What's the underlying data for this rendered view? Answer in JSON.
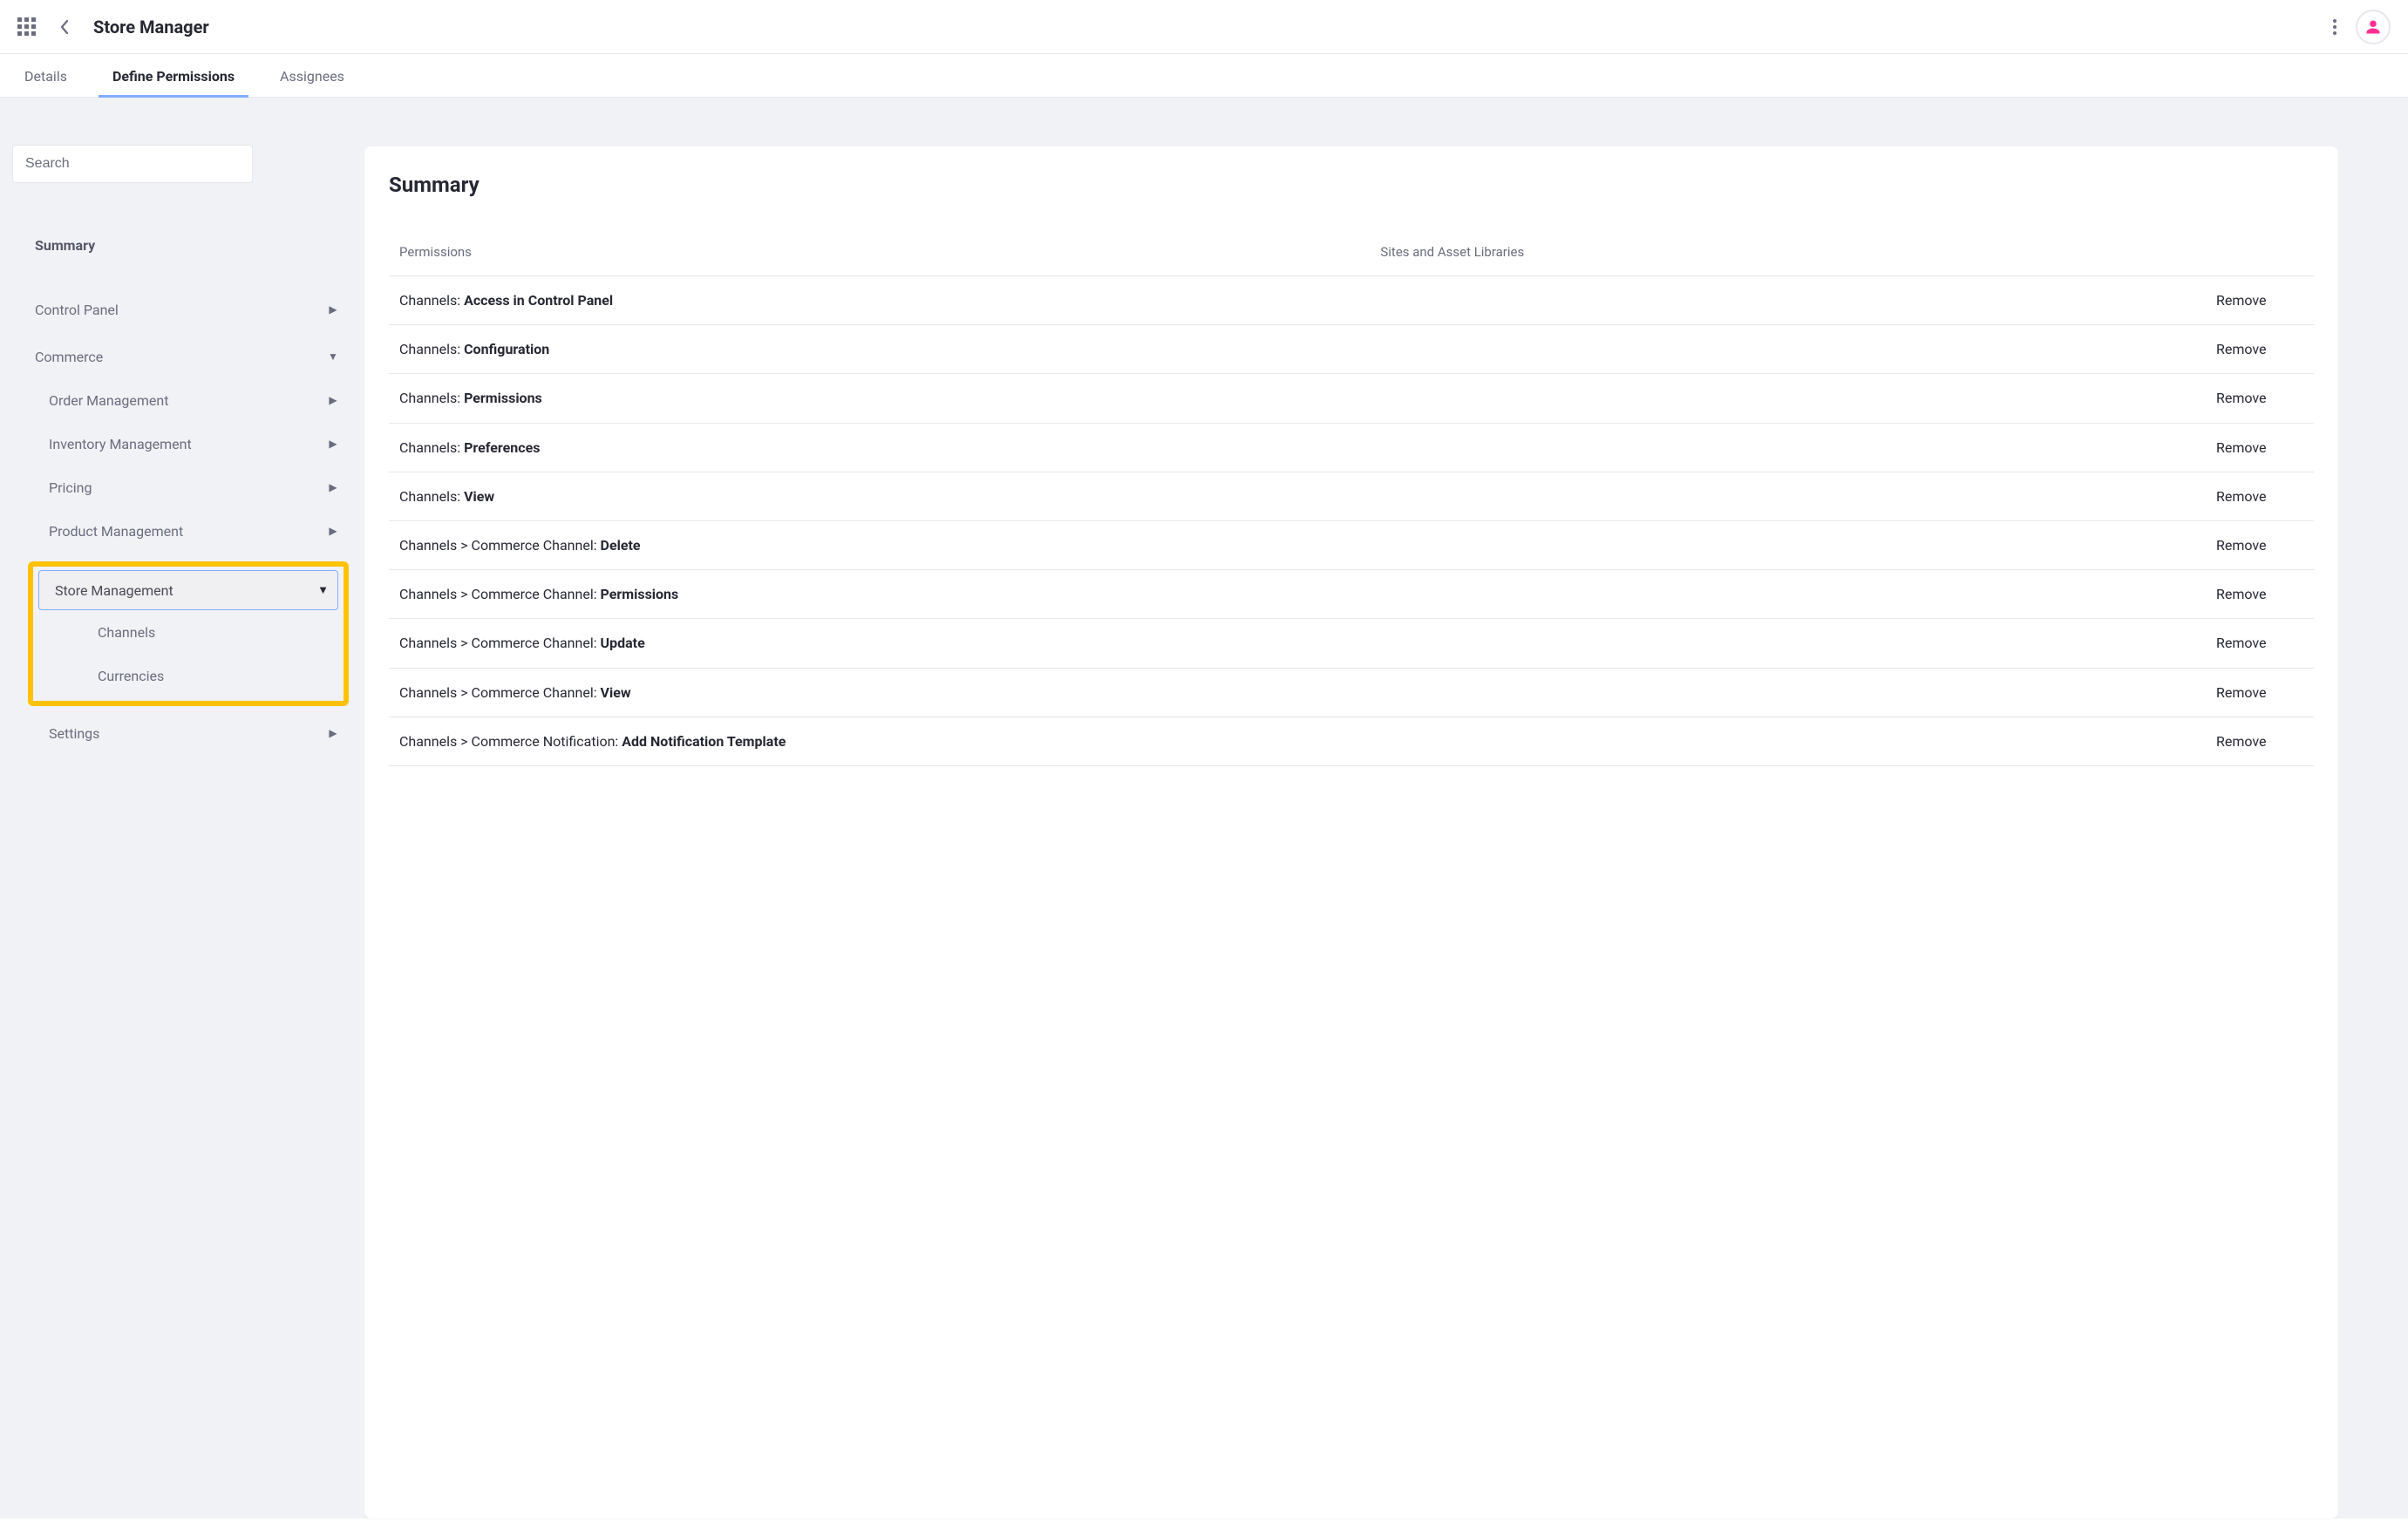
{
  "header": {
    "title": "Store Manager"
  },
  "tabs": {
    "details": "Details",
    "define_permissions": "Define Permissions",
    "assignees": "Assignees"
  },
  "sidebar": {
    "search_placeholder": "Search",
    "summary": "Summary",
    "control_panel": "Control Panel",
    "commerce": "Commerce",
    "commerce_children": {
      "order_management": "Order Management",
      "inventory_management": "Inventory Management",
      "pricing": "Pricing",
      "product_management": "Product Management",
      "store_management": "Store Management",
      "channels": "Channels",
      "currencies": "Currencies",
      "settings": "Settings"
    }
  },
  "main": {
    "title": "Summary",
    "columns": {
      "permissions": "Permissions",
      "sites": "Sites and Asset Libraries"
    },
    "remove_label": "Remove",
    "rows": [
      {
        "prefix": "Channels: ",
        "bold": "Access in Control Panel"
      },
      {
        "prefix": "Channels: ",
        "bold": "Configuration"
      },
      {
        "prefix": "Channels: ",
        "bold": "Permissions"
      },
      {
        "prefix": "Channels: ",
        "bold": "Preferences"
      },
      {
        "prefix": "Channels: ",
        "bold": "View"
      },
      {
        "prefix": "Channels > Commerce Channel: ",
        "bold": "Delete"
      },
      {
        "prefix": "Channels > Commerce Channel: ",
        "bold": "Permissions"
      },
      {
        "prefix": "Channels > Commerce Channel: ",
        "bold": "Update"
      },
      {
        "prefix": "Channels > Commerce Channel: ",
        "bold": "View"
      },
      {
        "prefix": "Channels > Commerce Notification: ",
        "bold": "Add Notification Template"
      }
    ]
  }
}
